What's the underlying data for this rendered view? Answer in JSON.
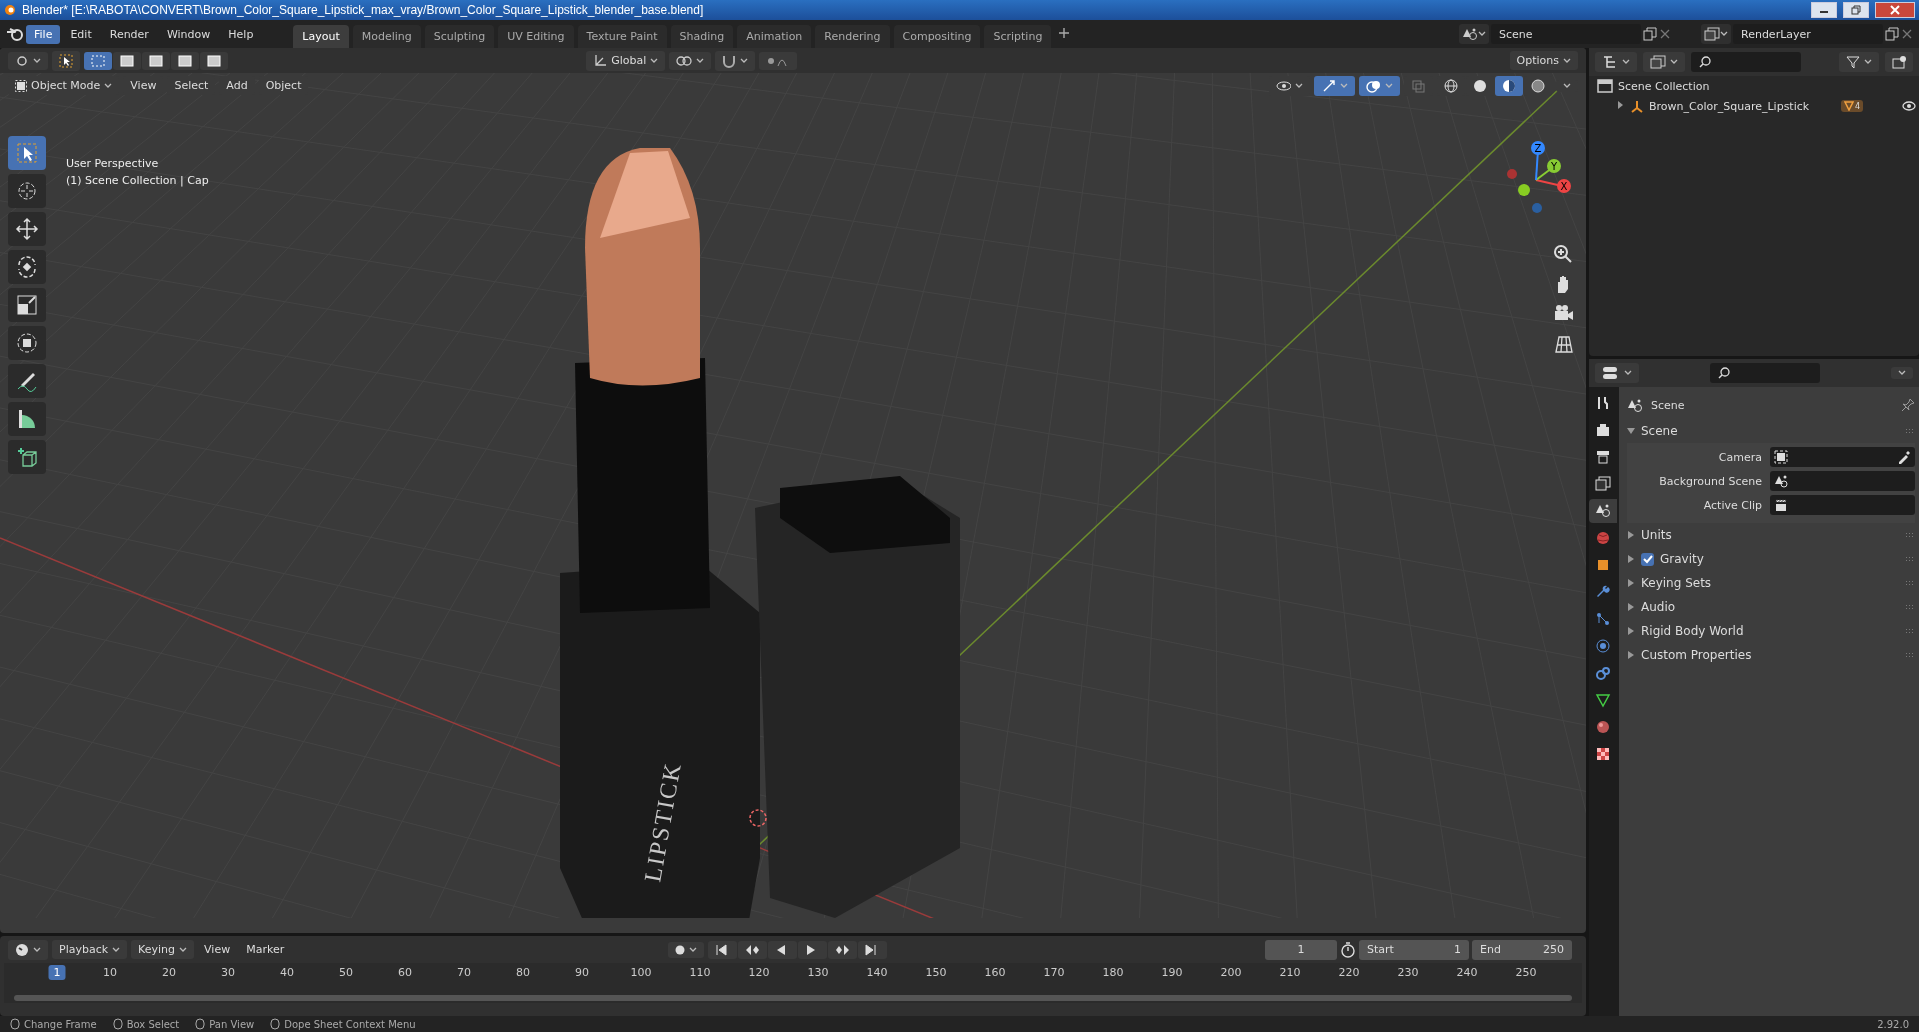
{
  "window": {
    "title": "Blender* [E:\\RABOTA\\CONVERT\\Brown_Color_Square_Lipstick_max_vray/Brown_Color_Square_Lipstick_blender_base.blend]"
  },
  "menu": [
    {
      "label": "File",
      "selected": true
    },
    {
      "label": "Edit",
      "selected": false
    },
    {
      "label": "Render",
      "selected": false
    },
    {
      "label": "Window",
      "selected": false
    },
    {
      "label": "Help",
      "selected": false
    }
  ],
  "workspaces": [
    {
      "label": "Layout",
      "selected": true
    },
    {
      "label": "Modeling",
      "selected": false
    },
    {
      "label": "Sculpting",
      "selected": false
    },
    {
      "label": "UV Editing",
      "selected": false
    },
    {
      "label": "Texture Paint",
      "selected": false
    },
    {
      "label": "Shading",
      "selected": false
    },
    {
      "label": "Animation",
      "selected": false
    },
    {
      "label": "Rendering",
      "selected": false
    },
    {
      "label": "Compositing",
      "selected": false
    },
    {
      "label": "Scripting",
      "selected": false
    }
  ],
  "top_right": {
    "scene": "Scene",
    "view_layer": "RenderLayer"
  },
  "tool_header": {
    "orientation": "Global",
    "options": "Options"
  },
  "viewport_header": {
    "mode": "Object Mode",
    "menus": [
      "View",
      "Select",
      "Add",
      "Object"
    ]
  },
  "viewport": {
    "view_name": "User Perspective",
    "context": "(1) Scene Collection | Cap",
    "tube_label": "LIPSTICK",
    "axes": [
      "X",
      "Y",
      "Z"
    ]
  },
  "toolbar": [
    {
      "kind": "select",
      "selected": true
    },
    {
      "kind": "cursor",
      "selected": false
    },
    {
      "kind": "move",
      "selected": false
    },
    {
      "kind": "rotate",
      "selected": false
    },
    {
      "kind": "scale",
      "selected": false
    },
    {
      "kind": "transform",
      "selected": false
    },
    {
      "kind": "annotate",
      "selected": false
    },
    {
      "kind": "measure",
      "selected": false
    },
    {
      "kind": "add_cube",
      "selected": false
    }
  ],
  "outliner": {
    "items": [
      {
        "label": "Scene Collection",
        "expanded": true,
        "children": [
          {
            "label": "Brown_Color_Square_Lipstick",
            "expanded": false,
            "badge": "4"
          }
        ]
      }
    ]
  },
  "properties": {
    "header": "Scene",
    "tabs": [
      {
        "kind": "tool",
        "selected": false
      },
      {
        "kind": "render",
        "selected": false
      },
      {
        "kind": "output",
        "selected": false
      },
      {
        "kind": "view_layer",
        "selected": false
      },
      {
        "kind": "scene",
        "selected": true
      },
      {
        "kind": "world",
        "selected": false
      },
      {
        "kind": "object",
        "selected": false
      },
      {
        "kind": "modifiers",
        "selected": false
      },
      {
        "kind": "particles",
        "selected": false
      },
      {
        "kind": "physics",
        "selected": false
      },
      {
        "kind": "constraints",
        "selected": false
      },
      {
        "kind": "data",
        "selected": false
      },
      {
        "kind": "material",
        "selected": false
      },
      {
        "kind": "texture",
        "selected": false
      }
    ],
    "panels": [
      {
        "kind": "plain",
        "label": "Scene",
        "expanded": true,
        "fields": [
          {
            "label": "Camera",
            "kind": "camera"
          },
          {
            "label": "Background Scene",
            "kind": "scene"
          },
          {
            "label": "Active Clip",
            "kind": "clip"
          }
        ]
      },
      {
        "kind": "plain",
        "label": "Units",
        "expanded": false
      },
      {
        "kind": "checkbox",
        "label": "Gravity",
        "expanded": false,
        "checked": true
      },
      {
        "kind": "plain",
        "label": "Keying Sets",
        "expanded": false
      },
      {
        "kind": "plain",
        "label": "Audio",
        "expanded": false
      },
      {
        "kind": "plain",
        "label": "Rigid Body World",
        "expanded": false
      },
      {
        "kind": "plain",
        "label": "Custom Properties",
        "expanded": false
      }
    ]
  },
  "timeline": {
    "menus": [
      "Playback",
      "Keying",
      "View",
      "Marker"
    ],
    "current_frame": "1",
    "start_label": "Start",
    "start": "1",
    "end_label": "End",
    "end": "250",
    "ticks": [
      {
        "label": "1",
        "selected": true
      },
      {
        "label": "10",
        "selected": false
      },
      {
        "label": "20",
        "selected": false
      },
      {
        "label": "30",
        "selected": false
      },
      {
        "label": "40",
        "selected": false
      },
      {
        "label": "50",
        "selected": false
      },
      {
        "label": "60",
        "selected": false
      },
      {
        "label": "70",
        "selected": false
      },
      {
        "label": "80",
        "selected": false
      },
      {
        "label": "90",
        "selected": false
      },
      {
        "label": "100",
        "selected": false
      },
      {
        "label": "110",
        "selected": false
      },
      {
        "label": "120",
        "selected": false
      },
      {
        "label": "130",
        "selected": false
      },
      {
        "label": "140",
        "selected": false
      },
      {
        "label": "150",
        "selected": false
      },
      {
        "label": "160",
        "selected": false
      },
      {
        "label": "170",
        "selected": false
      },
      {
        "label": "180",
        "selected": false
      },
      {
        "label": "190",
        "selected": false
      },
      {
        "label": "200",
        "selected": false
      },
      {
        "label": "210",
        "selected": false
      },
      {
        "label": "220",
        "selected": false
      },
      {
        "label": "230",
        "selected": false
      },
      {
        "label": "240",
        "selected": false
      },
      {
        "label": "250",
        "selected": false
      }
    ]
  },
  "status_bar": {
    "hints": [
      "Change Frame",
      "Box Select",
      "Pan View",
      "Dope Sheet Context Menu"
    ],
    "version": "2.92.0"
  }
}
